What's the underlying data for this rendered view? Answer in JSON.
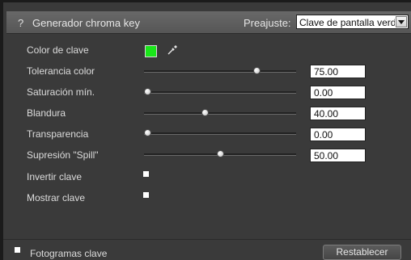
{
  "header": {
    "help_glyph": "?",
    "title": "Generador chroma key",
    "preset_label": "Preajuste:",
    "preset_value": "Clave de pantalla verde"
  },
  "key_color": {
    "label": "Color de clave",
    "swatch_color": "#19e619",
    "picker_icon": "eyedropper-icon"
  },
  "sliders": [
    {
      "label": "Tolerancia color",
      "value": "75.00",
      "position": 0.74
    },
    {
      "label": "Saturación mín.",
      "value": "0.00",
      "position": 0.02
    },
    {
      "label": "Blandura",
      "value": "40.00",
      "position": 0.4
    },
    {
      "label": "Transparencia",
      "value": "0.00",
      "position": 0.02
    },
    {
      "label": "Supresión \"Spill\"",
      "value": "50.00",
      "position": 0.5
    }
  ],
  "checkboxes": [
    {
      "label": "Invertir clave",
      "checked": false
    },
    {
      "label": "Mostrar clave",
      "checked": false
    }
  ],
  "footer": {
    "keyframes_label": "Fotogramas clave",
    "keyframes_checked": false,
    "reset_label": "Restablecer"
  }
}
